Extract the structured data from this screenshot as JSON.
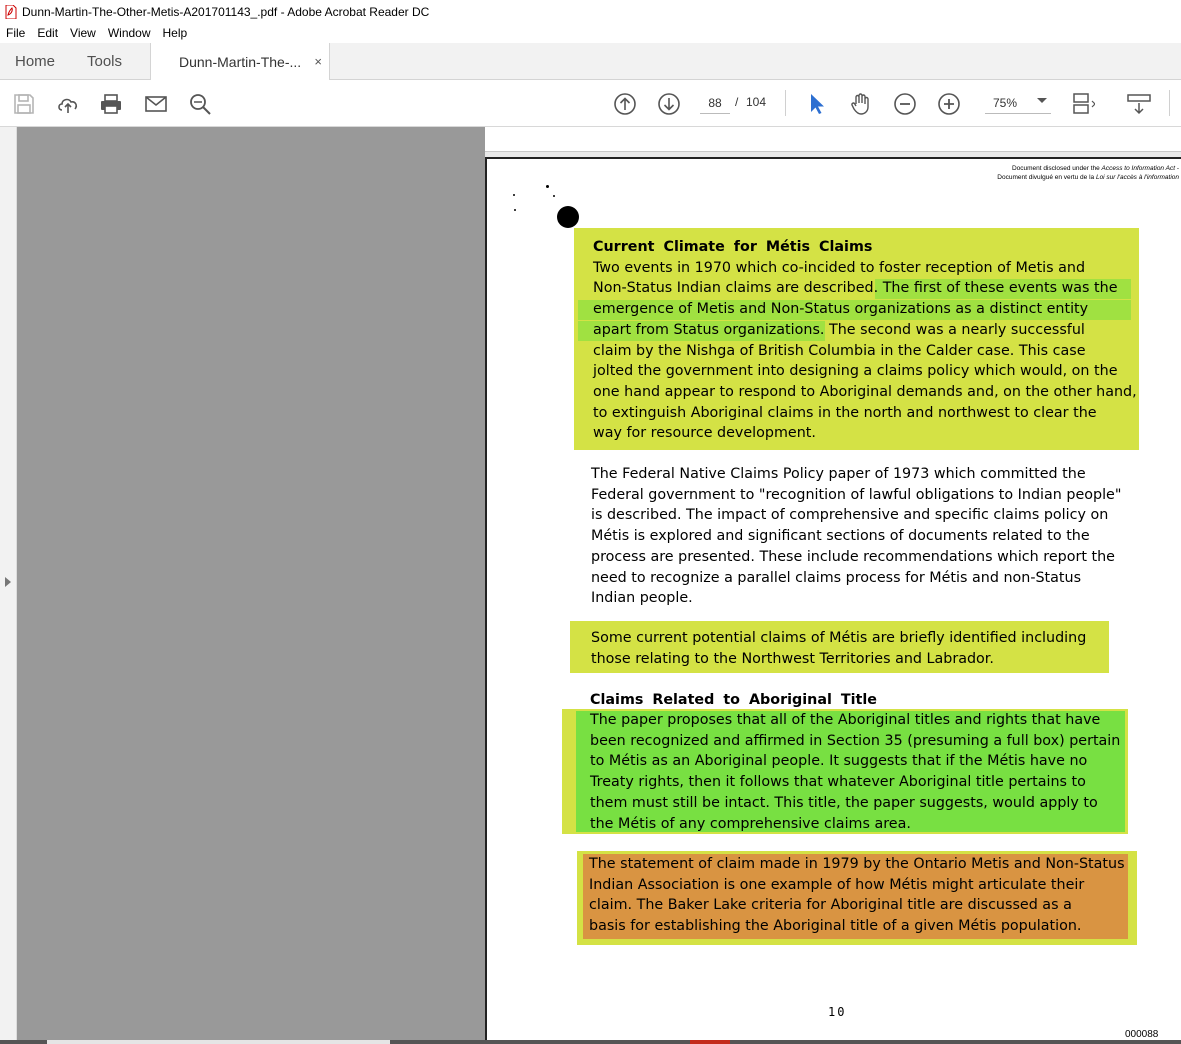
{
  "window": {
    "title": "Dunn-Martin-The-Other-Metis-A201701143_.pdf - Adobe Acrobat Reader DC"
  },
  "menu": [
    "File",
    "Edit",
    "View",
    "Window",
    "Help"
  ],
  "tabs": {
    "home": "Home",
    "tools": "Tools",
    "document": "Dunn-Martin-The-...",
    "close": "×"
  },
  "toolbar": {
    "icons": [
      "save-icon",
      "upload-icon",
      "print-icon",
      "mail-icon",
      "search-zoom-icon",
      "page-up-icon",
      "page-down-icon",
      "select-cursor-icon",
      "hand-icon",
      "zoom-out-icon",
      "zoom-in-icon",
      "fit-page-icon",
      "scroll-mode-icon"
    ],
    "current_page": "88",
    "page_separator": "/",
    "total_pages": "104",
    "zoom": "75%"
  },
  "document": {
    "disclosure_line1_prefix": "Document disclosed under the ",
    "disclosure_line1_italic": "Access to Information Act",
    "disclosure_line1_suffix": " -",
    "disclosure_line2_prefix": "Document divulgué en vertu de la ",
    "disclosure_line2_italic": "Loi sur l'accès à l'information",
    "section1": {
      "heading": "Current Climate for Métis Claims",
      "line1": "Two events in 1970 which co-incided to foster reception of Metis and",
      "line2_a": "Non-Status Indian claims are described. ",
      "line2_b": " The first of these events was the",
      "line3": "emergence of Metis and Non-Status organizations as a distinct entity",
      "line4_a": "apart from Status organizations.",
      "line4_b": "  The second was a nearly successful",
      "line5": "claim by the Nishga of British Columbia in the Calder case.   This case",
      "line6": "jolted the government into designing a claims policy which would, on the",
      "line7": "one hand appear to respond to Aboriginal demands and, on the other hand,",
      "line8": "to extinguish Aboriginal claims in the north and northwest to clear the",
      "line9": "way for resource development."
    },
    "section2": {
      "line1": "The Federal Native Claims Policy paper of 1973 which committed the",
      "line2": "Federal government to \"recognition of lawful obligations to Indian people\"",
      "line3": "is described.  The impact of comprehensive and specific claims policy on",
      "line4": "Métis is explored and significant sections of documents related to the",
      "line5": "process are presented. These include recommendations which report the",
      "line6": "need to recognize a parallel claims process for Métis and non-Status",
      "line7": "Indian people."
    },
    "section3": {
      "line1": "Some current potential claims of Métis are briefly identified including",
      "line2": "those relating to the Northwest Territories and Labrador."
    },
    "section4": {
      "heading": "Claims Related to Aboriginal Title",
      "line1": "The paper proposes that all of the Aboriginal titles and rights that have",
      "line2": "been recognized and affirmed in Section 35 (presuming a full box) pertain",
      "line3": "to Métis as an Aboriginal people. It suggests that if the Métis have no",
      "line4": "Treaty rights, then it follows that whatever Aboriginal title pertains to",
      "line5": "them must still be intact.  This title, the paper suggests,  would apply to",
      "line6": "the Métis of any comprehensive claims area."
    },
    "section5": {
      "line1": "The statement of claim made in 1979 by the Ontario Metis and Non-Status",
      "line2": "Indian Association is one example of how Métis might articulate their",
      "line3": "claim. The Baker Lake criteria for  Aboriginal title are discussed as a",
      "line4": "basis for establishing the Aboriginal title of a given Métis population."
    },
    "page_number": "10",
    "page_id": "000088"
  },
  "colors": {
    "highlight_yellow": "#d4e245",
    "highlight_green": "#78e042",
    "highlight_orange": "#d99442",
    "viewer_gray": "#999999"
  }
}
